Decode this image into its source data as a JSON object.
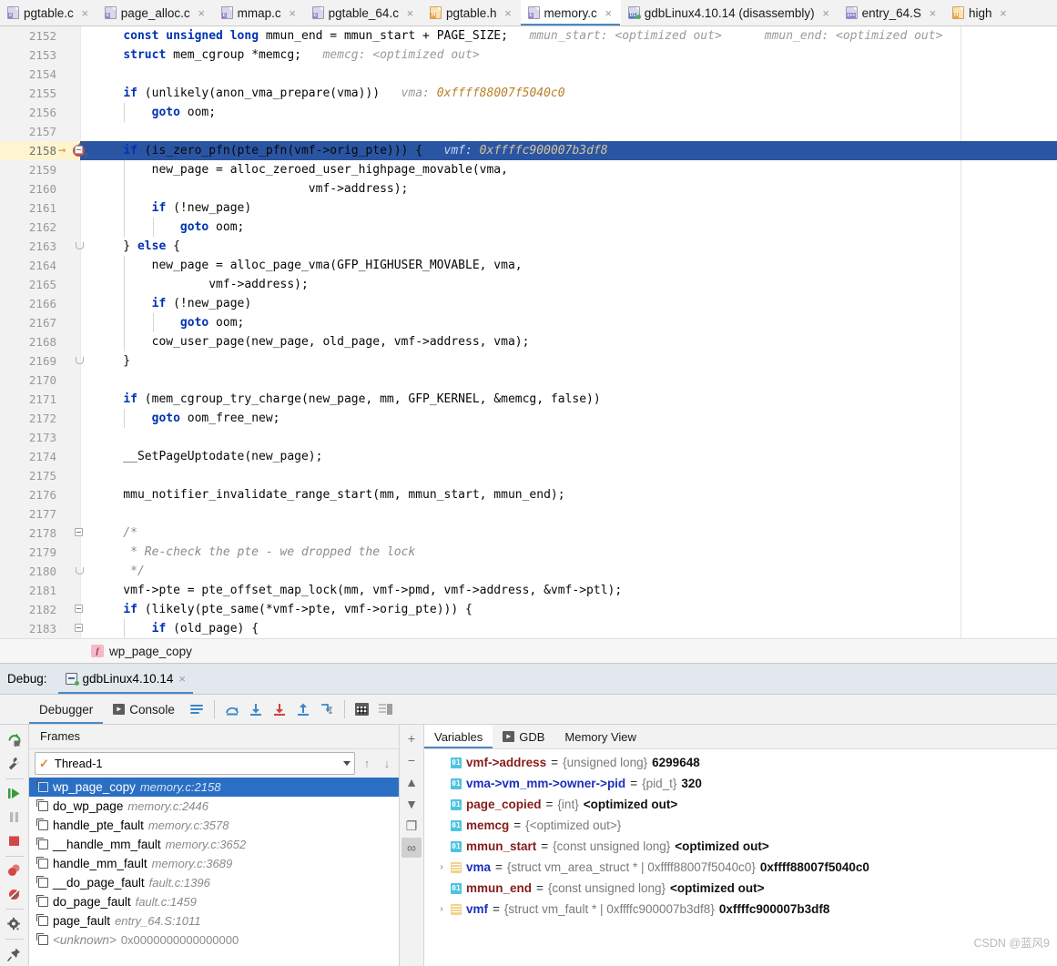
{
  "editor_tabs": [
    {
      "label": "pgtable.c",
      "ext": "c",
      "kind": "c",
      "active": false
    },
    {
      "label": "page_alloc.c",
      "ext": "c",
      "kind": "c",
      "active": false
    },
    {
      "label": "mmap.c",
      "ext": "c",
      "kind": "c",
      "active": false
    },
    {
      "label": "pgtable_64.c",
      "ext": "c",
      "kind": "c",
      "active": false
    },
    {
      "label": "pgtable.h",
      "ext": "H",
      "kind": "h",
      "active": false
    },
    {
      "label": "memory.c",
      "ext": "c",
      "kind": "c",
      "active": true
    },
    {
      "label": "gdbLinux4.10.14 (disassembly)",
      "ext": "01",
      "kind": "ot",
      "active": false
    },
    {
      "label": "entry_64.S",
      "ext": "c++",
      "kind": "cpp",
      "active": false
    },
    {
      "label": "high",
      "ext": "H",
      "kind": "h",
      "active": false
    }
  ],
  "tab_close_glyph": "×",
  "code": {
    "first_line": 2152,
    "current_line": 2158,
    "lines": [
      {
        "n": 2152,
        "indent": 0,
        "fold": "",
        "segments": [
          {
            "t": "    ",
            "c": "plain"
          },
          {
            "t": "const unsigned long",
            "c": "kw"
          },
          {
            "t": " mmun_end = mmun_start + PAGE_SIZE;",
            "c": "plain"
          },
          {
            "t": "   mmun_start: ",
            "c": "inlay"
          },
          {
            "t": "<optimized out>",
            "c": "inlay"
          },
          {
            "t": "      mmun_end: <optimized out>",
            "c": "inlay"
          }
        ]
      },
      {
        "n": 2153,
        "indent": 0,
        "fold": "",
        "segments": [
          {
            "t": "    ",
            "c": "plain"
          },
          {
            "t": "struct",
            "c": "kw"
          },
          {
            "t": " mem_cgroup *memcg;",
            "c": "plain"
          },
          {
            "t": "   memcg: <optimized out>",
            "c": "inlay"
          }
        ]
      },
      {
        "n": 2154,
        "indent": 0,
        "fold": "",
        "segments": []
      },
      {
        "n": 2155,
        "indent": 0,
        "fold": "",
        "segments": [
          {
            "t": "    ",
            "c": "plain"
          },
          {
            "t": "if",
            "c": "kw"
          },
          {
            "t": " (unlikely(anon_vma_prepare(vma)))",
            "c": "plain"
          },
          {
            "t": "   vma: ",
            "c": "inlay"
          },
          {
            "t": "0xffff88007f5040c0",
            "c": "inlay-val"
          }
        ]
      },
      {
        "n": 2156,
        "indent": 1,
        "fold": "",
        "segments": [
          {
            "t": "        ",
            "c": "plain"
          },
          {
            "t": "goto",
            "c": "kw"
          },
          {
            "t": " oom;",
            "c": "plain"
          }
        ]
      },
      {
        "n": 2157,
        "indent": 0,
        "fold": "",
        "segments": []
      },
      {
        "n": 2158,
        "indent": 0,
        "fold": "box",
        "current": true,
        "segments": [
          {
            "t": "    ",
            "c": "plain"
          },
          {
            "t": "if",
            "c": "kw"
          },
          {
            "t": " (is_zero_pfn(pte_pfn(vmf->orig_pte))) {",
            "c": "plain"
          },
          {
            "t": "   vmf: ",
            "c": "inlay"
          },
          {
            "t": "0xffffc900007b3df8",
            "c": "inlay-val"
          }
        ]
      },
      {
        "n": 2159,
        "indent": 1,
        "fold": "",
        "segments": [
          {
            "t": "        new_page = alloc_zeroed_user_highpage_movable(vma,",
            "c": "plain"
          }
        ]
      },
      {
        "n": 2160,
        "indent": 1,
        "fold": "",
        "segments": [
          {
            "t": "                              vmf->address);",
            "c": "plain"
          }
        ]
      },
      {
        "n": 2161,
        "indent": 1,
        "fold": "",
        "segments": [
          {
            "t": "        ",
            "c": "plain"
          },
          {
            "t": "if",
            "c": "kw"
          },
          {
            "t": " (!new_page)",
            "c": "plain"
          }
        ]
      },
      {
        "n": 2162,
        "indent": 2,
        "fold": "",
        "segments": [
          {
            "t": "            ",
            "c": "plain"
          },
          {
            "t": "goto",
            "c": "kw"
          },
          {
            "t": " oom;",
            "c": "plain"
          }
        ]
      },
      {
        "n": 2163,
        "indent": 0,
        "fold": "arc",
        "segments": [
          {
            "t": "    } ",
            "c": "plain"
          },
          {
            "t": "else",
            "c": "kw"
          },
          {
            "t": " {",
            "c": "plain"
          }
        ]
      },
      {
        "n": 2164,
        "indent": 1,
        "fold": "",
        "segments": [
          {
            "t": "        new_page = alloc_page_vma(GFP_HIGHUSER_MOVABLE, vma,",
            "c": "plain"
          }
        ]
      },
      {
        "n": 2165,
        "indent": 1,
        "fold": "",
        "segments": [
          {
            "t": "                vmf->address);",
            "c": "plain"
          }
        ]
      },
      {
        "n": 2166,
        "indent": 1,
        "fold": "",
        "segments": [
          {
            "t": "        ",
            "c": "plain"
          },
          {
            "t": "if",
            "c": "kw"
          },
          {
            "t": " (!new_page)",
            "c": "plain"
          }
        ]
      },
      {
        "n": 2167,
        "indent": 2,
        "fold": "",
        "segments": [
          {
            "t": "            ",
            "c": "plain"
          },
          {
            "t": "goto",
            "c": "kw"
          },
          {
            "t": " oom;",
            "c": "plain"
          }
        ]
      },
      {
        "n": 2168,
        "indent": 1,
        "fold": "",
        "segments": [
          {
            "t": "        cow_user_page(new_page, old_page, vmf->address, vma);",
            "c": "plain"
          }
        ]
      },
      {
        "n": 2169,
        "indent": 0,
        "fold": "arc",
        "segments": [
          {
            "t": "    }",
            "c": "plain"
          }
        ]
      },
      {
        "n": 2170,
        "indent": 0,
        "fold": "",
        "segments": []
      },
      {
        "n": 2171,
        "indent": 0,
        "fold": "",
        "segments": [
          {
            "t": "    ",
            "c": "plain"
          },
          {
            "t": "if",
            "c": "kw"
          },
          {
            "t": " (mem_cgroup_try_charge(new_page, mm, GFP_KERNEL, &memcg, false))",
            "c": "plain"
          }
        ]
      },
      {
        "n": 2172,
        "indent": 1,
        "fold": "",
        "segments": [
          {
            "t": "        ",
            "c": "plain"
          },
          {
            "t": "goto",
            "c": "kw"
          },
          {
            "t": " oom_free_new;",
            "c": "plain"
          }
        ]
      },
      {
        "n": 2173,
        "indent": 0,
        "fold": "",
        "segments": []
      },
      {
        "n": 2174,
        "indent": 0,
        "fold": "",
        "segments": [
          {
            "t": "    __SetPageUptodate(new_page);",
            "c": "plain"
          }
        ]
      },
      {
        "n": 2175,
        "indent": 0,
        "fold": "",
        "segments": []
      },
      {
        "n": 2176,
        "indent": 0,
        "fold": "",
        "segments": [
          {
            "t": "    mmu_notifier_invalidate_range_start(mm, mmun_start, mmun_end);",
            "c": "plain"
          }
        ]
      },
      {
        "n": 2177,
        "indent": 0,
        "fold": "",
        "segments": []
      },
      {
        "n": 2178,
        "indent": 0,
        "fold": "box",
        "segments": [
          {
            "t": "    /*",
            "c": "cmt"
          }
        ]
      },
      {
        "n": 2179,
        "indent": 0,
        "fold": "",
        "segments": [
          {
            "t": "     * Re-check the pte - we dropped the lock",
            "c": "cmt"
          }
        ]
      },
      {
        "n": 2180,
        "indent": 0,
        "fold": "arc",
        "segments": [
          {
            "t": "     */",
            "c": "cmt"
          }
        ]
      },
      {
        "n": 2181,
        "indent": 0,
        "fold": "",
        "segments": [
          {
            "t": "    vmf->pte = pte_offset_map_lock(mm, vmf->pmd, vmf->address, &vmf->ptl);",
            "c": "plain"
          }
        ]
      },
      {
        "n": 2182,
        "indent": 0,
        "fold": "box",
        "segments": [
          {
            "t": "    ",
            "c": "plain"
          },
          {
            "t": "if",
            "c": "kw"
          },
          {
            "t": " (likely(pte_same(*vmf->pte, vmf->orig_pte))) {",
            "c": "plain"
          }
        ]
      },
      {
        "n": 2183,
        "indent": 1,
        "fold": "box",
        "segments": [
          {
            "t": "        ",
            "c": "plain"
          },
          {
            "t": "if",
            "c": "kw"
          },
          {
            "t": " (old_page) {",
            "c": "plain"
          }
        ]
      }
    ]
  },
  "breadcrumb": {
    "function": "wp_page_copy",
    "icon": "f"
  },
  "debug_header": {
    "label": "Debug:",
    "session": "gdbLinux4.10.14",
    "close_glyph": "×"
  },
  "debug_toolbar": {
    "tabs": [
      {
        "label": "Debugger",
        "active": true,
        "icon": ""
      },
      {
        "label": "Console",
        "active": false,
        "icon": "console-icon"
      }
    ],
    "buttons": [
      {
        "name": "layout-settings-icon"
      },
      {
        "name": "step-over-icon"
      },
      {
        "name": "step-into-icon"
      },
      {
        "name": "force-step-into-icon"
      },
      {
        "name": "step-out-icon"
      },
      {
        "name": "run-to-cursor-icon"
      },
      {
        "name": "evaluate-expression-icon"
      },
      {
        "name": "show-values-inline-icon"
      }
    ]
  },
  "left_rail": [
    {
      "name": "rerun-icon"
    },
    {
      "name": "edit-configurations-icon"
    },
    {
      "name": "resume-program-icon"
    },
    {
      "name": "pause-program-icon"
    },
    {
      "name": "stop-icon"
    },
    {
      "name": "view-breakpoints-icon"
    },
    {
      "name": "mute-breakpoints-icon"
    },
    {
      "name": "settings-icon"
    },
    {
      "name": "pin-tab-icon"
    }
  ],
  "frames": {
    "title": "Frames",
    "thread": {
      "label": "Thread-1",
      "check": "✓"
    },
    "up_arrow": "↑",
    "down_arrow": "↓",
    "items": [
      {
        "name": "wp_page_copy",
        "loc": "memory.c:2158",
        "selected": true,
        "unknown": false
      },
      {
        "name": "do_wp_page",
        "loc": "memory.c:2446",
        "selected": false,
        "unknown": false
      },
      {
        "name": "handle_pte_fault",
        "loc": "memory.c:3578",
        "selected": false,
        "unknown": false
      },
      {
        "name": "__handle_mm_fault",
        "loc": "memory.c:3652",
        "selected": false,
        "unknown": false
      },
      {
        "name": "handle_mm_fault",
        "loc": "memory.c:3689",
        "selected": false,
        "unknown": false
      },
      {
        "name": "__do_page_fault",
        "loc": "fault.c:1396",
        "selected": false,
        "unknown": false
      },
      {
        "name": "do_page_fault",
        "loc": "fault.c:1459",
        "selected": false,
        "unknown": false
      },
      {
        "name": "page_fault",
        "loc": "entry_64.S:1011",
        "selected": false,
        "unknown": false
      },
      {
        "name": "<unknown>",
        "loc": "0x0000000000000000",
        "selected": false,
        "unknown": true
      }
    ]
  },
  "vars_side_buttons": [
    {
      "name": "add-watch-icon",
      "glyph": "+",
      "boxed": false
    },
    {
      "name": "remove-watch-icon",
      "glyph": "−",
      "boxed": false
    },
    {
      "name": "move-up-icon",
      "glyph": "▲",
      "boxed": false
    },
    {
      "name": "move-down-icon",
      "glyph": "▼",
      "boxed": false
    },
    {
      "name": "copy-value-icon",
      "glyph": "❐",
      "boxed": false
    },
    {
      "name": "watches-icon",
      "glyph": "∞",
      "boxed": true
    }
  ],
  "variables": {
    "tabs": [
      {
        "label": "Variables",
        "active": true,
        "icon": ""
      },
      {
        "label": "GDB",
        "active": false,
        "icon": "console-icon"
      },
      {
        "label": "Memory View",
        "active": false,
        "icon": ""
      }
    ],
    "rows": [
      {
        "expandable": false,
        "icon": "prim",
        "name": "vmf->address",
        "name_style": "red",
        "type": "{unsigned long}",
        "value": "6299648"
      },
      {
        "expandable": false,
        "icon": "prim",
        "name": "vma->vm_mm->owner->pid",
        "name_style": "blue",
        "type": "{pid_t}",
        "value": "320"
      },
      {
        "expandable": false,
        "icon": "prim",
        "name": "page_copied",
        "name_style": "red",
        "type": "{int}",
        "value": "<optimized out>"
      },
      {
        "expandable": false,
        "icon": "prim",
        "name": "memcg",
        "name_style": "red",
        "type": "{<optimized out>}",
        "value": ""
      },
      {
        "expandable": false,
        "icon": "prim",
        "name": "mmun_start",
        "name_style": "red",
        "type": "{const unsigned long}",
        "value": "<optimized out>"
      },
      {
        "expandable": true,
        "icon": "struct",
        "name": "vma",
        "name_style": "blue",
        "type": "{struct vm_area_struct * | 0xffff88007f5040c0}",
        "value": "0xffff88007f5040c0"
      },
      {
        "expandable": false,
        "icon": "prim",
        "name": "mmun_end",
        "name_style": "red",
        "type": "{const unsigned long}",
        "value": "<optimized out>"
      },
      {
        "expandable": true,
        "icon": "struct",
        "name": "vmf",
        "name_style": "blue",
        "type": "{struct vm_fault * | 0xffffc900007b3df8}",
        "value": "0xffffc900007b3df8"
      }
    ],
    "expander_glyph": "›",
    "prim_icon_text": "01"
  },
  "watermark": "CSDN @蓝风9",
  "colors": {
    "accent": "#4a88c7",
    "selection": "#2a55a3",
    "frame_selection": "#2a6fc4",
    "keyword": "#0033b3",
    "comment": "#8c8c8c",
    "inlay_value": "#b9802a",
    "breakpoint": "#d44646",
    "var_name": "#871c1c",
    "var_name_blue": "#1a2fbf"
  }
}
